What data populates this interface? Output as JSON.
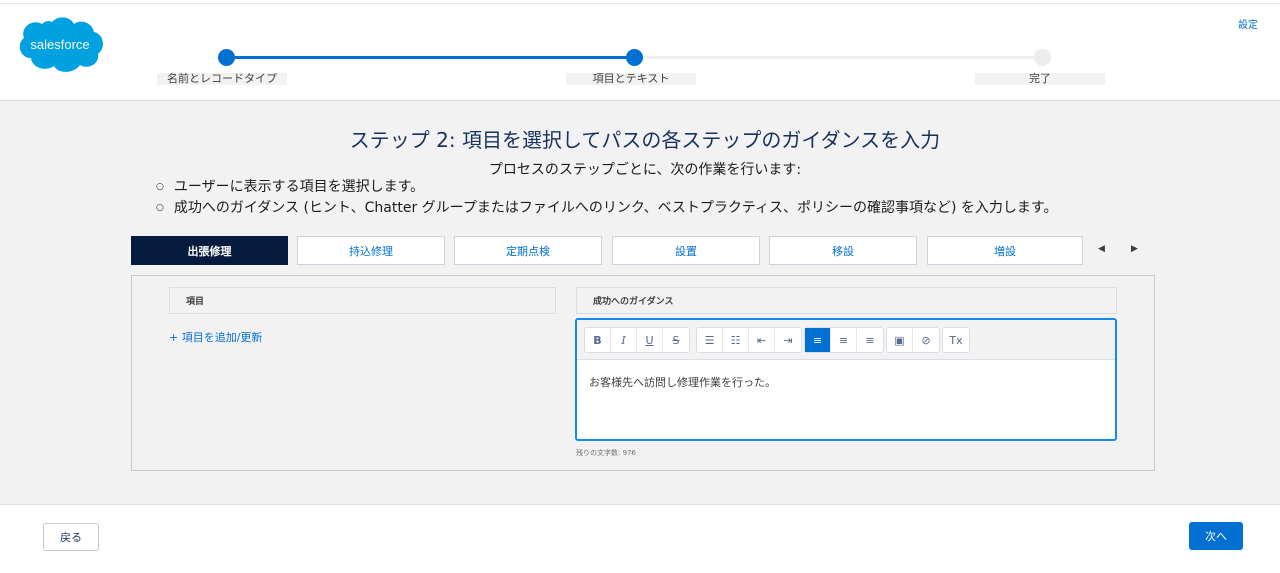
{
  "header": {
    "logo_text": "salesforce",
    "settings_label": "設定",
    "steps": [
      {
        "label": "名前とレコードタイプ"
      },
      {
        "label": "項目とテキスト"
      },
      {
        "label": "完了"
      }
    ]
  },
  "content": {
    "title": "ステップ 2: 項目を選択してパスの各ステップのガイダンスを入力",
    "subtitle": "プロセスのステップごとに、次の作業を行います:",
    "bullets": [
      "ユーザーに表示する項目を選択します。",
      "成功へのガイダンス (ヒント、Chatter グループまたはファイルへのリンク、ベストプラクティス、ポリシーの確認事項など) を入力します。"
    ]
  },
  "tabs": [
    "出張修理",
    "持込修理",
    "定期点検",
    "設置",
    "移設",
    "増設"
  ],
  "tab_nav": {
    "prev": "◀",
    "next": "▶"
  },
  "fields_panel": {
    "header": "項目",
    "add_link": "+ 項目を追加/更新"
  },
  "guidance_panel": {
    "header": "成功へのガイダンス",
    "toolbar": {
      "bold": "B",
      "italic": "I",
      "underline": "U",
      "strike": "S",
      "bullet_list": "☰",
      "numbered_list": "☷",
      "outdent": "⇤",
      "indent": "⇥",
      "align_left": "≡",
      "align_center": "≡",
      "align_right": "≡",
      "image": "▣",
      "link": "⊘",
      "clear_format": "Tx"
    },
    "text": "お客様先へ訪問し修理作業を行った。",
    "char_count": "残りの文字数: 976"
  },
  "footer": {
    "back_label": "戻る",
    "next_label": "次へ"
  },
  "colors": {
    "brand": "#0070d2",
    "active_tab": "#061c3f",
    "logo": "#00a1e0"
  }
}
